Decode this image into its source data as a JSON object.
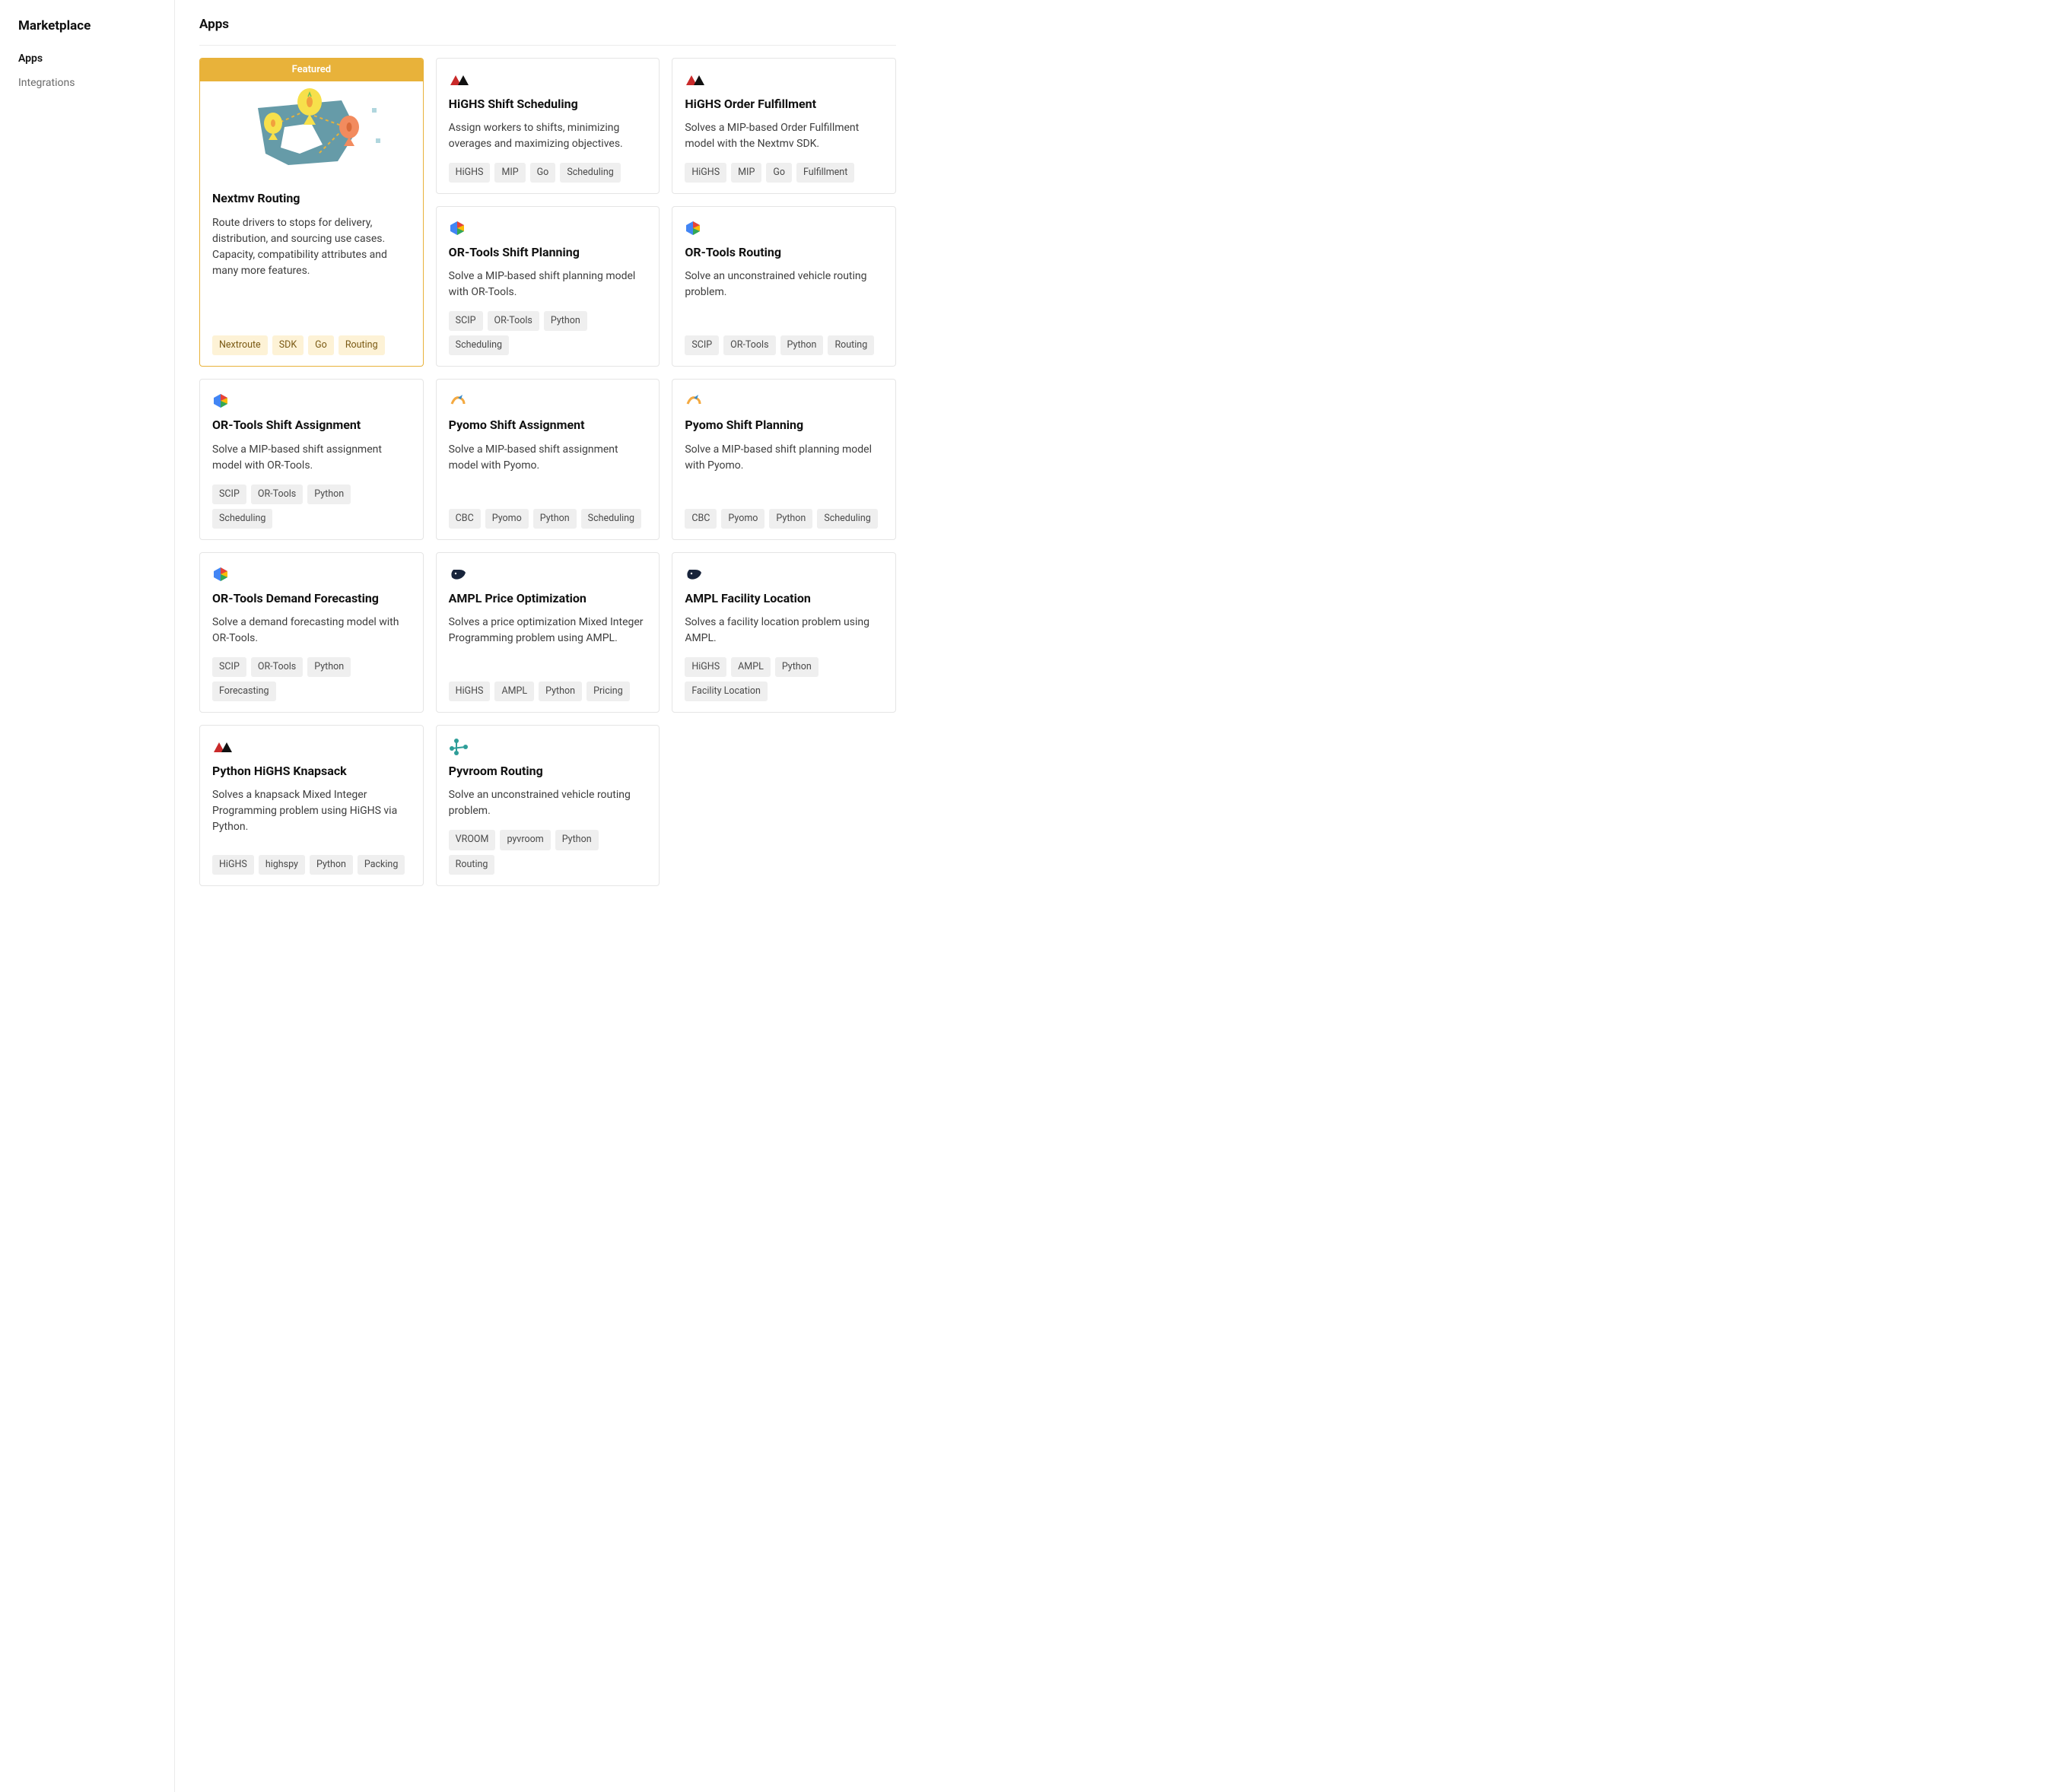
{
  "sidebar": {
    "title": "Marketplace",
    "items": [
      {
        "label": "Apps",
        "active": true
      },
      {
        "label": "Integrations",
        "active": false
      }
    ]
  },
  "page": {
    "title": "Apps"
  },
  "featured": {
    "banner": "Featured",
    "title": "Nextmv Routing",
    "description": "Route drivers to stops for delivery, distribution, and sourcing use cases. Capacity, compatibility attributes and many more features.",
    "tags": [
      "Nextroute",
      "SDK",
      "Go",
      "Routing"
    ]
  },
  "apps": [
    {
      "icon": "highs",
      "title": "HiGHS Shift Scheduling",
      "description": "Assign workers to shifts, minimizing overages and maximizing objectives.",
      "tags": [
        "HiGHS",
        "MIP",
        "Go",
        "Scheduling"
      ]
    },
    {
      "icon": "highs",
      "title": "HiGHS Order Fulfillment",
      "description": "Solves a MIP-based Order Fulfillment model with the Nextmv SDK.",
      "tags": [
        "HiGHS",
        "MIP",
        "Go",
        "Fulfillment"
      ]
    },
    {
      "icon": "ortools",
      "title": "OR-Tools Shift Planning",
      "description": "Solve a MIP-based shift planning model with OR-Tools.",
      "tags": [
        "SCIP",
        "OR-Tools",
        "Python",
        "Scheduling"
      ]
    },
    {
      "icon": "ortools",
      "title": "OR-Tools Routing",
      "description": "Solve an unconstrained vehicle routing problem.",
      "tags": [
        "SCIP",
        "OR-Tools",
        "Python",
        "Routing"
      ]
    },
    {
      "icon": "ortools",
      "title": "OR-Tools Shift Assignment",
      "description": "Solve a MIP-based shift assignment model with OR-Tools.",
      "tags": [
        "SCIP",
        "OR-Tools",
        "Python",
        "Scheduling"
      ]
    },
    {
      "icon": "pyomo",
      "title": "Pyomo Shift Assignment",
      "description": "Solve a MIP-based shift assignment model with Pyomo.",
      "tags": [
        "CBC",
        "Pyomo",
        "Python",
        "Scheduling"
      ]
    },
    {
      "icon": "pyomo",
      "title": "Pyomo Shift Planning",
      "description": "Solve a MIP-based shift planning model with Pyomo.",
      "tags": [
        "CBC",
        "Pyomo",
        "Python",
        "Scheduling"
      ]
    },
    {
      "icon": "ortools",
      "title": "OR-Tools Demand Forecasting",
      "description": "Solve a demand forecasting model with OR-Tools.",
      "tags": [
        "SCIP",
        "OR-Tools",
        "Python",
        "Forecasting"
      ]
    },
    {
      "icon": "ampl",
      "title": "AMPL Price Optimization",
      "description": "Solves a price optimization Mixed Integer Programming problem using AMPL.",
      "tags": [
        "HiGHS",
        "AMPL",
        "Python",
        "Pricing"
      ]
    },
    {
      "icon": "ampl",
      "title": "AMPL Facility Location",
      "description": "Solves a facility location problem using AMPL.",
      "tags": [
        "HiGHS",
        "AMPL",
        "Python",
        "Facility Location"
      ]
    },
    {
      "icon": "highs",
      "title": "Python HiGHS Knapsack",
      "description": "Solves a knapsack Mixed Integer Programming problem using HiGHS via Python.",
      "tags": [
        "HiGHS",
        "highspy",
        "Python",
        "Packing"
      ]
    },
    {
      "icon": "vroom",
      "title": "Pyvroom Routing",
      "description": "Solve an unconstrained vehicle routing problem.",
      "tags": [
        "VROOM",
        "pyvroom",
        "Python",
        "Routing"
      ]
    }
  ]
}
